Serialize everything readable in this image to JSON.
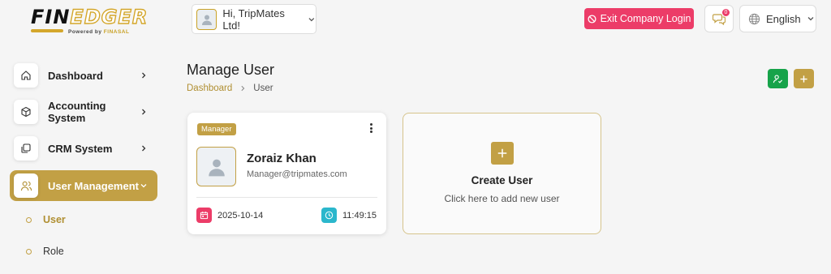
{
  "brand": {
    "logo_fin": "FIN",
    "logo_edger": "EDGER",
    "logo_powered": "Powered by",
    "logo_company": "FINASAL"
  },
  "header": {
    "company_label": "Hi, TripMates Ltd!",
    "exit_label": "Exit Company Login",
    "notification_count": "0",
    "language": "English"
  },
  "sidebar": {
    "items": [
      {
        "label": "Dashboard",
        "icon": "home-icon"
      },
      {
        "label": "Accounting System",
        "icon": "box-icon"
      },
      {
        "label": "CRM System",
        "icon": "layers-icon"
      },
      {
        "label": "User Management",
        "icon": "users-icon"
      }
    ],
    "sub_items": [
      {
        "label": "User"
      },
      {
        "label": "Role"
      }
    ]
  },
  "page": {
    "title": "Manage User",
    "breadcrumb": {
      "root": "Dashboard",
      "current": "User"
    }
  },
  "user_card": {
    "role": "Manager",
    "name": "Zoraiz Khan",
    "email": "Manager@tripmates.com",
    "date": "2025-10-14",
    "time": "11:49:15"
  },
  "create_card": {
    "title": "Create User",
    "subtitle": "Click here to add new user"
  },
  "colors": {
    "accent_gold": "#c2a045",
    "danger_pink": "#ec3c68",
    "success_green": "#17a34a",
    "clock_teal": "#2bb7cc"
  }
}
